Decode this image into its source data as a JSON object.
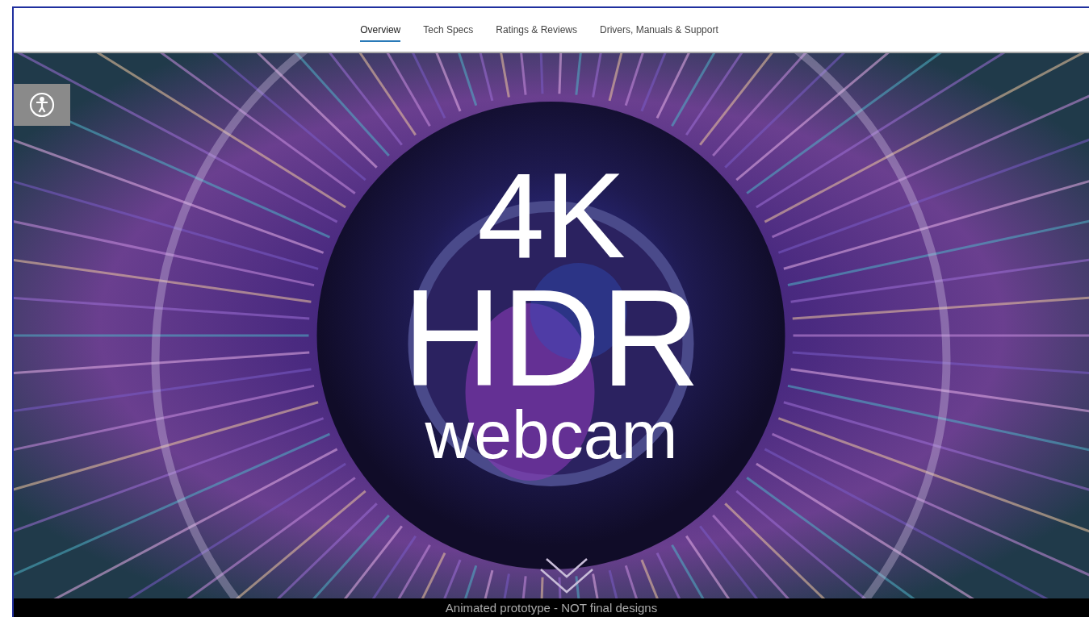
{
  "nav": {
    "tabs": [
      {
        "label": "Overview",
        "selected": true
      },
      {
        "label": "Tech Specs",
        "selected": false
      },
      {
        "label": "Ratings & Reviews",
        "selected": false
      },
      {
        "label": "Drivers, Manuals & Support",
        "selected": false
      }
    ]
  },
  "hero": {
    "kind": "picture",
    "headline": [
      "4K",
      "HDR",
      "webcam"
    ]
  },
  "caption": "Animated prototype - NOT final designs"
}
